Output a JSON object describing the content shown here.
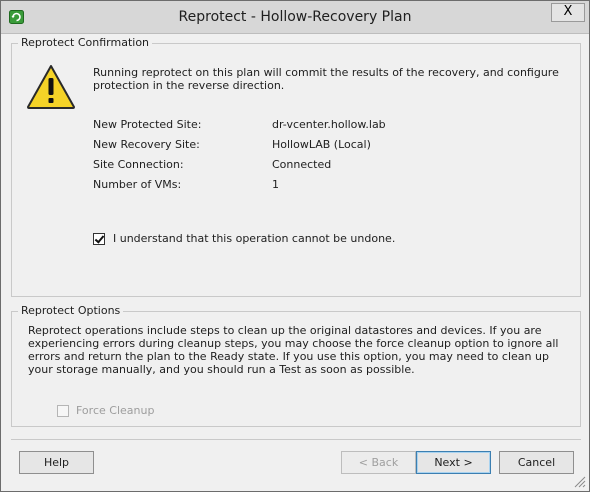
{
  "window": {
    "title": "Reprotect - Hollow-Recovery Plan",
    "close_label": "X"
  },
  "confirmation": {
    "group_title": "Reprotect Confirmation",
    "message": "Running reprotect on this plan will commit the results of the recovery, and configure protection in the reverse direction.",
    "rows": [
      {
        "label": "New Protected Site:",
        "value": "dr-vcenter.hollow.lab"
      },
      {
        "label": "New Recovery Site:",
        "value": "HollowLAB (Local)"
      },
      {
        "label": "Site Connection:",
        "value": "Connected"
      },
      {
        "label": "Number of VMs:",
        "value": "1"
      }
    ],
    "acknowledge": {
      "label": "I understand that this operation cannot be undone.",
      "checked": true
    }
  },
  "options": {
    "group_title": "Reprotect Options",
    "description": "Reprotect operations include steps to clean up the original datastores and devices. If you are experiencing errors during cleanup steps, you may choose the force cleanup option to ignore all errors and return the plan to the Ready state. If you use this option, you may need to clean up your storage manually, and you should run a Test as soon as possible.",
    "force_cleanup": {
      "label": "Force Cleanup",
      "checked": false,
      "enabled": false
    }
  },
  "buttons": {
    "help": "Help",
    "back": "< Back",
    "next": "Next >",
    "cancel": "Cancel"
  },
  "icons": {
    "app": "recovery-plan-icon",
    "warning": "warning-icon",
    "close": "close-icon"
  },
  "colors": {
    "warning_fill": "#f5d327",
    "titlebar": "#d7d7d7",
    "app_icon": "#3a9b3a"
  }
}
